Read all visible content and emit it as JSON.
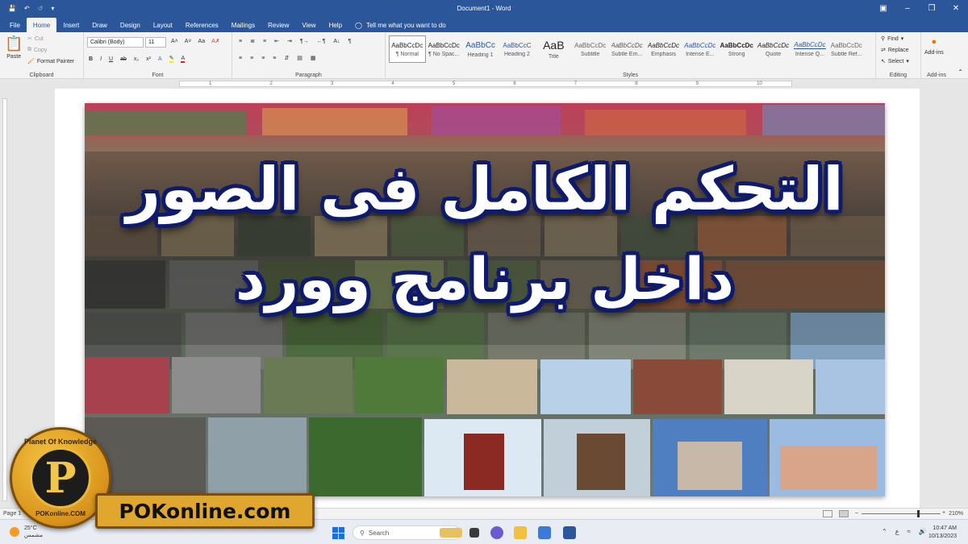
{
  "titlebar": {
    "title": "Document1  -  Word",
    "quick_access": [
      "save-icon",
      "undo-icon",
      "redo-icon",
      "customize-icon"
    ],
    "window_controls": [
      "ribbon-display-icon",
      "minimize-icon",
      "restore-icon",
      "close-icon"
    ]
  },
  "tabs": [
    {
      "label": "File",
      "active": false
    },
    {
      "label": "Home",
      "active": true
    },
    {
      "label": "Insert",
      "active": false
    },
    {
      "label": "Draw",
      "active": false
    },
    {
      "label": "Design",
      "active": false
    },
    {
      "label": "Layout",
      "active": false
    },
    {
      "label": "References",
      "active": false
    },
    {
      "label": "Mailings",
      "active": false
    },
    {
      "label": "Review",
      "active": false
    },
    {
      "label": "View",
      "active": false
    },
    {
      "label": "Help",
      "active": false
    }
  ],
  "tell_me": "Tell me what you want to do",
  "clipboard": {
    "label": "Clipboard",
    "paste": "Paste",
    "cut": "Cut",
    "copy": "Copy",
    "format_painter": "Format Painter"
  },
  "font": {
    "label": "Font",
    "family": "Calibri (Body)",
    "size": "11",
    "bold": "B",
    "italic": "I",
    "underline": "U"
  },
  "paragraph": {
    "label": "Paragraph"
  },
  "styles": {
    "label": "Styles",
    "items": [
      {
        "sample": "AaBbCcDc",
        "name": "¶ Normal"
      },
      {
        "sample": "AaBbCcDc",
        "name": "¶ No Spac..."
      },
      {
        "sample": "AaBbCc",
        "name": "Heading 1"
      },
      {
        "sample": "AaBbCcC",
        "name": "Heading 2"
      },
      {
        "sample": "AaB",
        "name": "Title"
      },
      {
        "sample": "AaBbCcDc",
        "name": "Subtitle"
      },
      {
        "sample": "AaBbCcDc",
        "name": "Subtle Em..."
      },
      {
        "sample": "AaBbCcDc",
        "name": "Emphasis"
      },
      {
        "sample": "AaBbCcDc",
        "name": "Intense E..."
      },
      {
        "sample": "AaBbCcDc",
        "name": "Strong"
      },
      {
        "sample": "AaBbCcDc",
        "name": "Quote"
      },
      {
        "sample": "AaBbCcDc",
        "name": "Intense Q..."
      },
      {
        "sample": "AaBbCcDc",
        "name": "Subtle Ref..."
      }
    ]
  },
  "editing": {
    "label": "Editing",
    "find": "Find",
    "replace": "Replace",
    "select": "Select"
  },
  "addins": {
    "label": "Add-ins",
    "button": "Add-ins"
  },
  "headline": {
    "line1": "التحكم الكامل فى الصور",
    "line2": "داخل برنامج وورد"
  },
  "logo": {
    "letter": "P",
    "ring_top": "Planet Of Knowledge",
    "ring_bottom": "POKonline.COM",
    "banner": "POKonline.com"
  },
  "status": {
    "page": "Page 1",
    "zoom": "210%"
  },
  "taskbar": {
    "temp": "25°C",
    "weather_text": "مشمس",
    "search": "Search",
    "lang": "ع",
    "time": "10:47 AM",
    "date": "10/13/2023"
  },
  "colors": {
    "word_blue": "#2b579a",
    "headline_outline": "#0e1a6b",
    "logo_gold": "#e0a72f"
  }
}
